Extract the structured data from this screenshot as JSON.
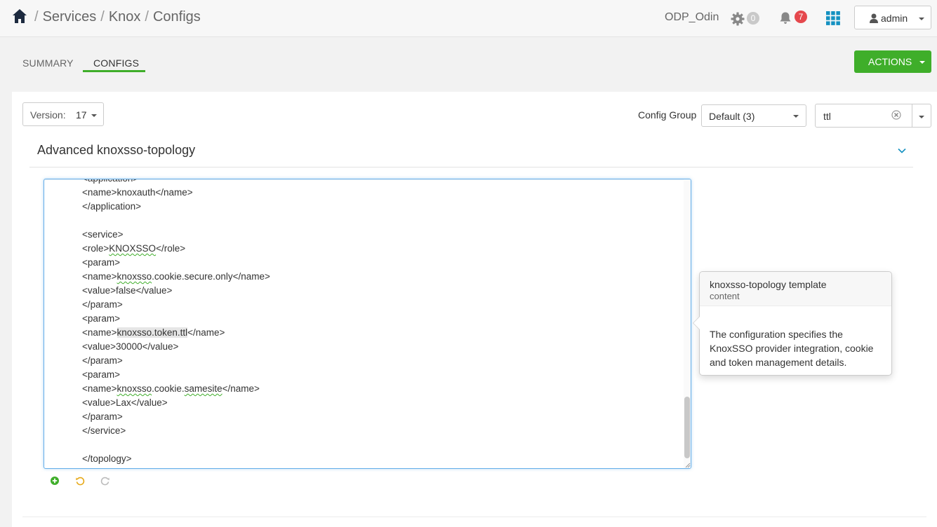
{
  "breadcrumb": {
    "items": [
      "Services",
      "Knox",
      "Configs"
    ],
    "separator": "/"
  },
  "header": {
    "cluster_name": "ODP_Odin",
    "ops_count": "0",
    "alerts_count": "7",
    "user_label": "admin"
  },
  "tabs": [
    {
      "label": "SUMMARY",
      "active": false
    },
    {
      "label": "CONFIGS",
      "active": true
    }
  ],
  "actions": {
    "label": "ACTIONS"
  },
  "toolbar": {
    "version_label": "Version:",
    "version_value": "17",
    "config_group_label": "Config Group",
    "config_group_value": "Default (3)",
    "filter_value": "ttl"
  },
  "section": {
    "title": "Advanced knoxsso-topology"
  },
  "editor": {
    "lines": [
      "<application>",
      "<name>knoxauth</name>",
      "</application>",
      "",
      "<service>",
      "<role>KNOXSSO</role>",
      "<param>",
      "<name>knoxsso.cookie.secure.only</name>",
      "<value>false</value>",
      "</param>",
      "<param>",
      "<name>knoxsso.token.ttl</name>",
      "<value>30000</value>",
      "</param>",
      "<param>",
      "<name>knoxsso.cookie.samesite</name>",
      "<value>Lax</value>",
      "</param>",
      "</service>",
      "",
      "</topology>"
    ]
  },
  "popover": {
    "title": "knoxsso-topology template",
    "subtitle": "content",
    "body": "The configuration specifies the KnoxSSO provider integration, cookie and token management details."
  },
  "colors": {
    "accent_green": "#3fae2a",
    "alert_red": "#e5484d",
    "link_blue": "#1491c1"
  }
}
